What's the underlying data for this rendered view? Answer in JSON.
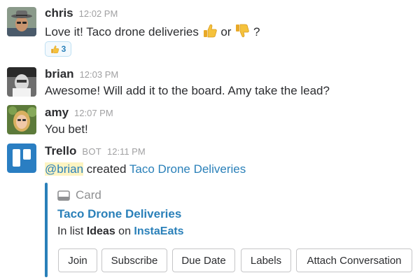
{
  "messages": [
    {
      "author": "chris",
      "time": "12:02 PM",
      "text_before": "Love it! Taco drone deliveries",
      "text_between": "or",
      "text_after": "?",
      "emoji_1": "thumbs-up",
      "emoji_2": "thumbs-down",
      "reaction": {
        "emoji": "thumbs-up",
        "count": "3"
      }
    },
    {
      "author": "brian",
      "time": "12:03 PM",
      "text": "Awesome! Will add it to the board. Amy take the lead?"
    },
    {
      "author": "amy",
      "time": "12:07 PM",
      "text": "You bet!"
    },
    {
      "author": "Trello",
      "badge": "BOT",
      "time": "12:11 PM",
      "mention": "@brian",
      "action": "created",
      "link": "Taco Drone Deliveries"
    }
  ],
  "card": {
    "header": "Card",
    "title": "Taco Drone Deliveries",
    "list_prefix": "In list",
    "list_name": "Ideas",
    "list_on": "on",
    "board": "InstaEats",
    "buttons": [
      "Join",
      "Subscribe",
      "Due Date",
      "Labels",
      "Attach Conversation"
    ]
  },
  "colors": {
    "link": "#2a80b9",
    "mention_highlight": "#fdf4c2",
    "trello_blue": "#2a7ec2",
    "timestamp": "#a0a0a2"
  }
}
